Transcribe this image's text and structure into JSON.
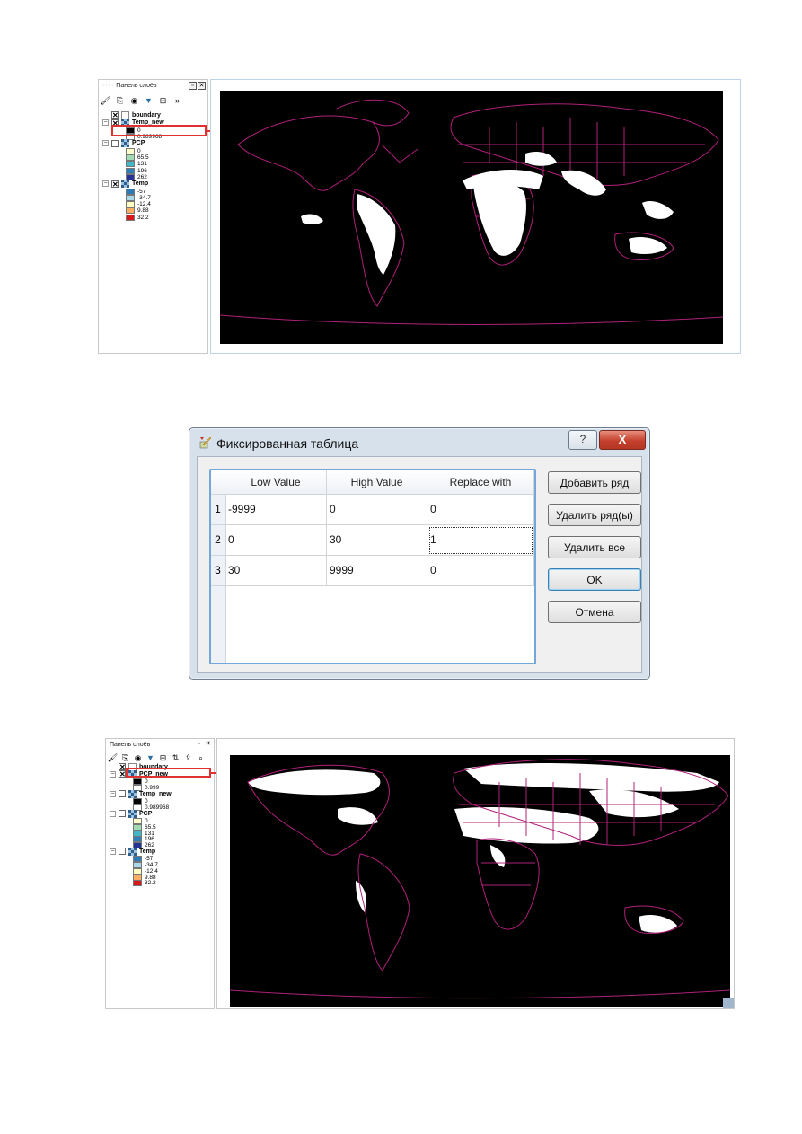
{
  "panel1": {
    "title": "Панель слоёв",
    "layers": [
      {
        "name": "boundary",
        "checked": true,
        "legend": []
      },
      {
        "name": "Temp_new",
        "checked": true,
        "legend": [
          {
            "color": "#000000",
            "label": "0"
          },
          {
            "color": "#ffffff",
            "label": "0.989968"
          }
        ]
      },
      {
        "name": "PCP",
        "checked": false,
        "legend": [
          {
            "color": "#ffffcc",
            "label": "0"
          },
          {
            "color": "#a1dab4",
            "label": "65.5"
          },
          {
            "color": "#41b6c4",
            "label": "131"
          },
          {
            "color": "#2c7fb8",
            "label": "196"
          },
          {
            "color": "#253494",
            "label": "262"
          }
        ]
      },
      {
        "name": "Temp",
        "checked": true,
        "legend": [
          {
            "color": "#2c7bb6",
            "label": "-57"
          },
          {
            "color": "#abd9e9",
            "label": "-34.7"
          },
          {
            "color": "#ffffbf",
            "label": "-12.4"
          },
          {
            "color": "#fdae61",
            "label": "9.88"
          },
          {
            "color": "#d7191c",
            "label": "32.2"
          }
        ]
      }
    ]
  },
  "dialog": {
    "title": "Фиксированная таблица",
    "help_label": "?",
    "close_label": "X",
    "columns": [
      "Low Value",
      "High Value",
      "Replace with"
    ],
    "rows": [
      {
        "num": "1",
        "low": "-9999",
        "high": "0",
        "replace": "0"
      },
      {
        "num": "2",
        "low": "0",
        "high": "30",
        "replace": "1"
      },
      {
        "num": "3",
        "low": "30",
        "high": "9999",
        "replace": "0"
      }
    ],
    "buttons": {
      "add_row": "Добавить ряд",
      "delete_rows": "Удалить ряд(ы)",
      "delete_all": "Удалить все",
      "ok": "OK",
      "cancel": "Отмена"
    }
  },
  "panel2": {
    "title": "Панель слоёв",
    "layers": [
      {
        "name": "boundary",
        "checked": true,
        "legend": []
      },
      {
        "name": "PCP_new",
        "checked": true,
        "legend": [
          {
            "color": "#000000",
            "label": "0"
          },
          {
            "color": "#ffffff",
            "label": "0.999"
          }
        ]
      },
      {
        "name": "Temp_new",
        "checked": false,
        "legend": [
          {
            "color": "#000000",
            "label": "0"
          },
          {
            "color": "#ffffff",
            "label": "0.989968"
          }
        ]
      },
      {
        "name": "PCP",
        "checked": false,
        "legend": [
          {
            "color": "#ffffcc",
            "label": "0"
          },
          {
            "color": "#a1dab4",
            "label": "65.5"
          },
          {
            "color": "#41b6c4",
            "label": "131"
          },
          {
            "color": "#2c7fb8",
            "label": "196"
          },
          {
            "color": "#253494",
            "label": "262"
          }
        ]
      },
      {
        "name": "Temp",
        "checked": false,
        "legend": [
          {
            "color": "#2c7bb6",
            "label": "-57"
          },
          {
            "color": "#abd9e9",
            "label": "-34.7"
          },
          {
            "color": "#ffffbf",
            "label": "-12.4"
          },
          {
            "color": "#fdae61",
            "label": "9.88"
          },
          {
            "color": "#d7191c",
            "label": "32.2"
          }
        ]
      }
    ]
  },
  "colors": {
    "highlight": "#e03030",
    "boundary": "#b0207a",
    "map_bg": "#000000"
  }
}
